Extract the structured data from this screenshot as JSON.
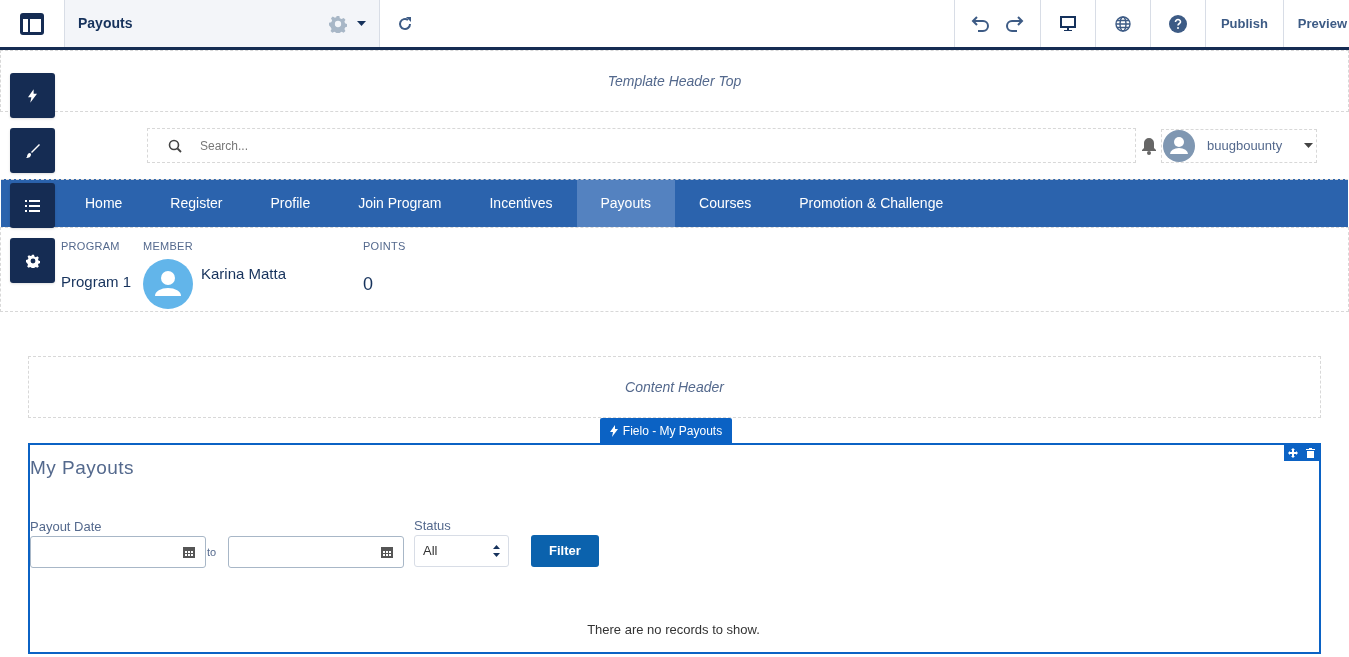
{
  "toolbar": {
    "page_title": "Payouts",
    "actions": [
      "Publish",
      "Preview"
    ]
  },
  "header_top": {
    "label": "Template Header Top"
  },
  "search": {
    "placeholder": "Search..."
  },
  "user": {
    "name": "buugbouunty"
  },
  "nav": [
    {
      "label": "Home",
      "selected": false
    },
    {
      "label": "Register",
      "selected": false
    },
    {
      "label": "Profile",
      "selected": false
    },
    {
      "label": "Join Program",
      "selected": false
    },
    {
      "label": "Incentives",
      "selected": false
    },
    {
      "label": "Payouts",
      "selected": true
    },
    {
      "label": "Courses",
      "selected": false
    },
    {
      "label": "Promotion & Challenge",
      "selected": false
    }
  ],
  "member_bar": [
    {
      "kind": "text",
      "label": "PROGRAM",
      "value": "Program 1"
    },
    {
      "kind": "member",
      "label": "MEMBER",
      "value": "Karina Matta"
    },
    {
      "kind": "number",
      "label": "POINTS",
      "value": "0"
    }
  ],
  "content_header": {
    "label": "Content Header"
  },
  "component": {
    "tag": "Fielo - My Payouts",
    "title": "My Payouts",
    "date_label": "Payout Date",
    "separator": "to",
    "status_label": "Status",
    "status_value": "All",
    "button": "Filter",
    "empty_message": "There are no records to show."
  }
}
